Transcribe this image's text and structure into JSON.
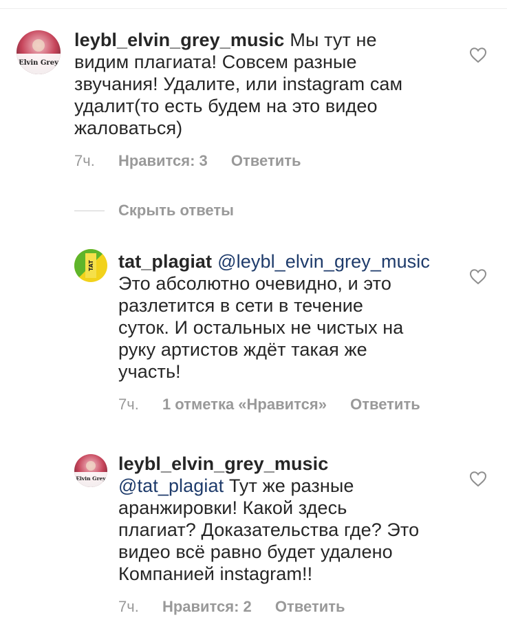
{
  "comments": [
    {
      "username": "leybl_elvin_grey_music",
      "mention": "",
      "text_lines": [
        "Мы тут не",
        "видим плагиата! Совсем разные",
        "звучания! Удалите, или instagram сам",
        "удалит(то есть будем на это видео",
        "жаловаться)"
      ],
      "time": "7ч.",
      "likes": "Нравится: 3",
      "reply": "Ответить",
      "avatar_text": "Elvin Grey"
    },
    {
      "username": "tat_plagiat",
      "mention": "@leybl_elvin_grey_music",
      "text_lines": [
        "Это абсолютно очевидно, и это",
        "разлетится в сети в течение",
        "суток. И остальных не чистых на",
        "руку артистов ждёт такая же",
        "участь!"
      ],
      "time": "7ч.",
      "likes": "1 отметка «Нравится»",
      "reply": "Ответить",
      "avatar_text": "TAT"
    },
    {
      "username": "leybl_elvin_grey_music",
      "mention": "@tat_plagiat",
      "text_lines": [
        "Тут же разные",
        "аранжировки! Какой здесь",
        "плагиат? Доказательства где? Это",
        "видео всё равно будет удалено",
        "Компанией instagram!!"
      ],
      "time": "7ч.",
      "likes": "Нравится: 2",
      "reply": "Ответить",
      "avatar_text": "Elvin Grey"
    }
  ],
  "hide_replies_label": "Скрыть ответы",
  "icons": {
    "like": "heart-icon"
  },
  "colors": {
    "text": "#262626",
    "meta": "#999999",
    "mention": "#1e3b6b",
    "tat_green": "#5fb52a",
    "tat_yellow": "#f2d21b"
  }
}
